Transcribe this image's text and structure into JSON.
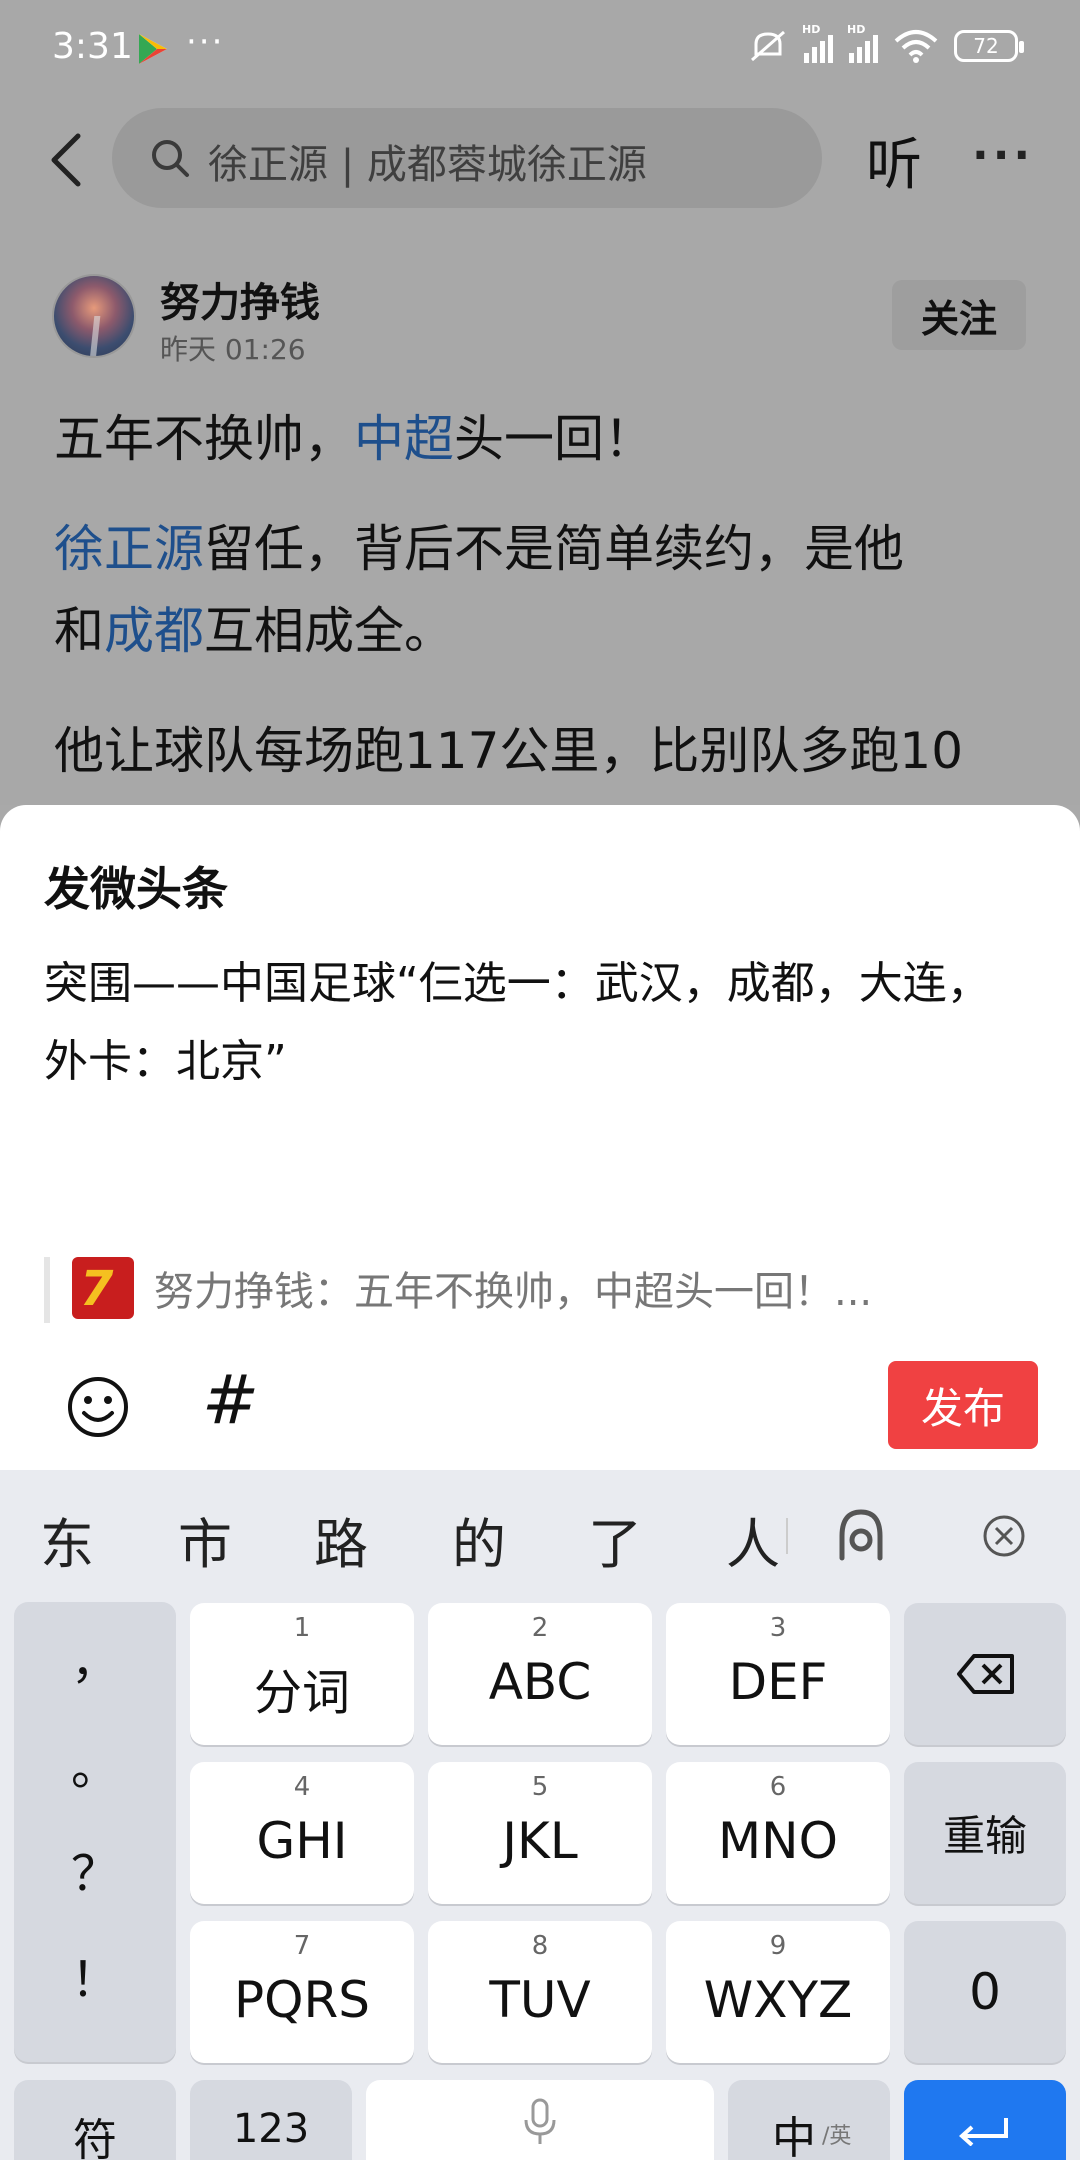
{
  "status_bar": {
    "time": "3:31",
    "dots": "···",
    "battery": "72"
  },
  "header": {
    "search_text": "徐正源 | 成都蓉城徐正源",
    "listen": "听"
  },
  "article": {
    "author": "努力挣钱",
    "time": "昨天  01:26",
    "follow": "关注",
    "p1": {
      "a": "五年不换帅，",
      "link": "中超",
      "b": "头一回！"
    },
    "p2": {
      "link1": "徐正源",
      "a": "留任，背后不是简单续约，是他",
      "b": "和",
      "link2": "成都",
      "c": "互相成全。"
    },
    "p3": "他让球队每场跑117公里，比别队多跑10"
  },
  "compose": {
    "title": "发微头条",
    "text": "突围——中国足球“仨选一：武汉，成都，大连，外卡：北京”",
    "quote": "努力挣钱：五年不换帅，中超头一回！...",
    "quote_thumb": "7",
    "hash": "#",
    "publish": "发布"
  },
  "keyboard": {
    "candidates": [
      "东",
      "市",
      "路",
      "的",
      "了",
      "人"
    ],
    "punct": [
      "，",
      "。",
      "？",
      "！"
    ],
    "keys": [
      {
        "num": "1",
        "label": "分词"
      },
      {
        "num": "2",
        "label": "ABC"
      },
      {
        "num": "3",
        "label": "DEF"
      },
      {
        "num": "4",
        "label": "GHI"
      },
      {
        "num": "5",
        "label": "JKL"
      },
      {
        "num": "6",
        "label": "MNO"
      },
      {
        "num": "7",
        "label": "PQRS"
      },
      {
        "num": "8",
        "label": "TUV"
      },
      {
        "num": "9",
        "label": "WXYZ"
      }
    ],
    "reinput": "重输",
    "zero": "0",
    "symbol": "符",
    "num123": "123",
    "lang_main": "中",
    "lang_sub": "/英"
  }
}
